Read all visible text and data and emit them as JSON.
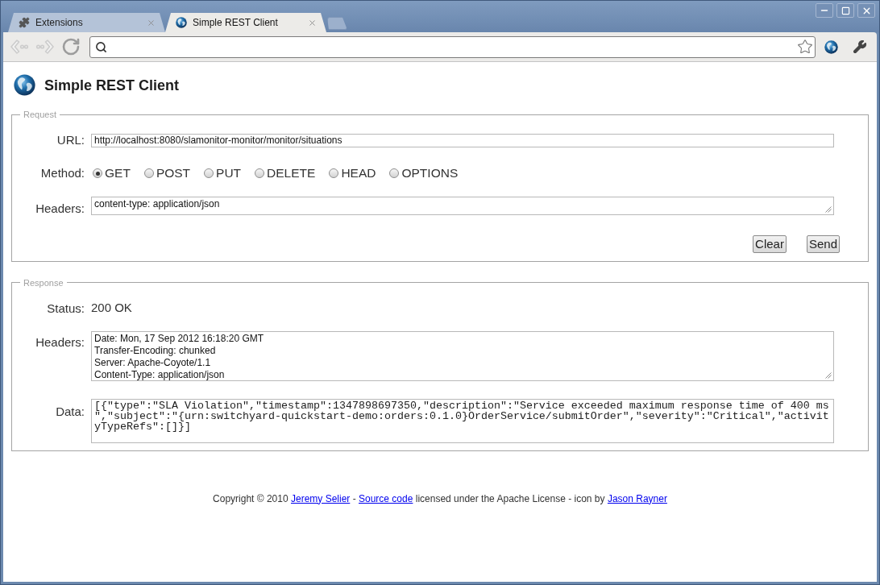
{
  "tabs": [
    {
      "label": "Extensions",
      "kind": "extension",
      "selected": false
    },
    {
      "label": "Simple REST Client",
      "kind": "site",
      "selected": true
    }
  ],
  "toolbar": {
    "nav_buttons": [
      {
        "kind": "back",
        "disabled": true
      },
      {
        "kind": "forward",
        "disabled": true
      },
      {
        "kind": "reload",
        "disabled": false
      }
    ]
  },
  "page": {
    "title": "Simple REST Client"
  },
  "request": {
    "legend": "Request",
    "url_label": "URL:",
    "url": "http://localhost:8080/slamonitor-monitor/monitor/situations",
    "method_label": "Method:",
    "methods": [
      {
        "label": "GET",
        "selected": true
      },
      {
        "label": "POST",
        "selected": false
      },
      {
        "label": "PUT",
        "selected": false
      },
      {
        "label": "DELETE",
        "selected": false
      },
      {
        "label": "HEAD",
        "selected": false
      },
      {
        "label": "OPTIONS",
        "selected": false
      }
    ],
    "headers_label": "Headers:",
    "headers": "content-type: application/json",
    "buttons": [
      "Clear",
      "Send"
    ]
  },
  "response": {
    "legend": "Response",
    "status_label": "Status:",
    "status": "200 OK",
    "headers_label": "Headers:",
    "headers": [
      "Date: Mon, 17 Sep 2012 16:18:20 GMT",
      "Transfer-Encoding: chunked",
      "Server: Apache-Coyote/1.1",
      "Content-Type: application/json"
    ],
    "data_label": "Data:",
    "data": "[{\"type\":\"SLA Violation\",\"timestamp\":1347898697350,\"description\":\"Service exceeded maximum response time of 400 ms\",\"subject\":\"{urn:switchyard-quickstart-demo:orders:0.1.0}OrderService/submitOrder\",\"severity\":\"Critical\",\"activityTypeRefs\":[]}]"
  },
  "footer": [
    {
      "kind": "text",
      "text": "Copyright © 2010 "
    },
    {
      "kind": "link",
      "text": "Jeremy Selier"
    },
    {
      "kind": "text",
      "text": " - "
    },
    {
      "kind": "link",
      "text": "Source code"
    },
    {
      "kind": "text",
      "text": " licensed under the Apache License - icon by "
    },
    {
      "kind": "link",
      "text": "Jason Rayner"
    }
  ]
}
